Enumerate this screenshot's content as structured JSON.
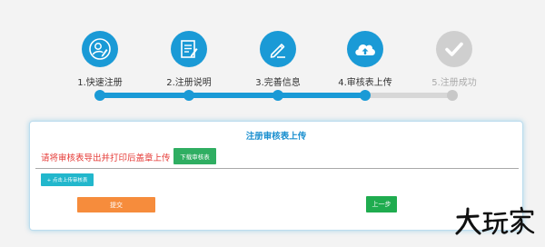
{
  "steps": [
    {
      "label": "1.快速注册",
      "icon": "user-edit-icon",
      "state": "done"
    },
    {
      "label": "2.注册说明",
      "icon": "document-edit-icon",
      "state": "done"
    },
    {
      "label": "3.完善信息",
      "icon": "pencil-icon",
      "state": "done"
    },
    {
      "label": "4.审核表上传",
      "icon": "cloud-upload-icon",
      "state": "done"
    },
    {
      "label": "5.注册成功",
      "icon": "checkmark-icon",
      "state": "todo"
    }
  ],
  "card": {
    "title": "注册审核表上传",
    "notice": "请将审核表导出并打印后盖章上传",
    "download_label": "下载审核表",
    "upload_label": "+ 点击上传审核表",
    "submit_label": "提交",
    "prev_label": "上一步"
  },
  "watermark": "大玩家",
  "colors": {
    "accent": "#1a9ad6",
    "inactive": "#cfcfcf",
    "notice": "#e53935",
    "download": "#2fae62",
    "upload": "#22b7cc",
    "submit": "#f68c3c",
    "prev": "#1fac4f"
  }
}
